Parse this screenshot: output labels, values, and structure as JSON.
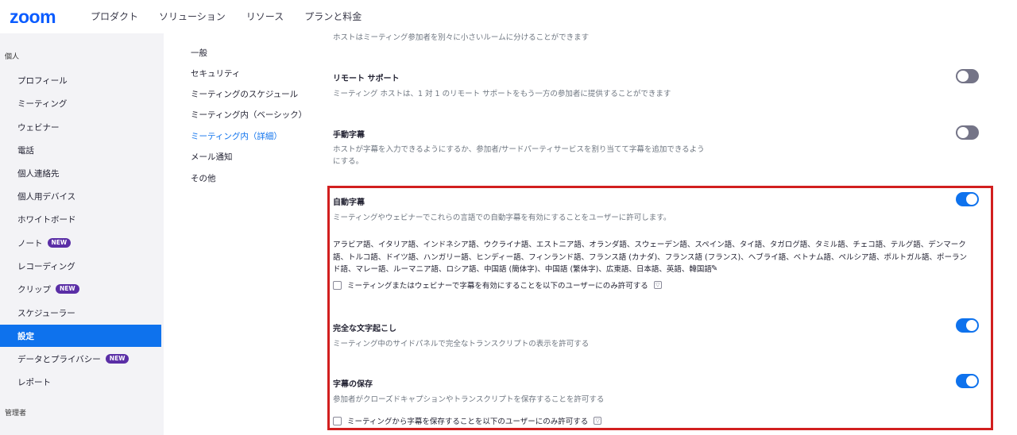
{
  "header": {
    "logo": "zoom",
    "nav": [
      "プロダクト",
      "ソリューション",
      "リソース",
      "プランと料金"
    ]
  },
  "sidebar": {
    "personal_label": "個人",
    "admin_label": "管理者",
    "items": [
      {
        "label": "プロフィール"
      },
      {
        "label": "ミーティング"
      },
      {
        "label": "ウェビナー"
      },
      {
        "label": "電話"
      },
      {
        "label": "個人連絡先"
      },
      {
        "label": "個人用デバイス"
      },
      {
        "label": "ホワイトボード"
      },
      {
        "label": "ノート",
        "badge": "NEW"
      },
      {
        "label": "レコーディング"
      },
      {
        "label": "クリップ",
        "badge": "NEW"
      },
      {
        "label": "スケジューラー"
      },
      {
        "label": "設定"
      },
      {
        "label": "データとプライバシー",
        "badge": "NEW"
      },
      {
        "label": "レポート"
      }
    ]
  },
  "subnav": [
    "一般",
    "セキュリティ",
    "ミーティングのスケジュール",
    "ミーティング内（ベーシック）",
    "ミーティング内（詳細）",
    "メール通知",
    "その他"
  ],
  "settings": {
    "breakout_desc": "ホストはミーティング参加者を別々に小さいルームに分けることができます",
    "remote_support": {
      "title": "リモート サポート",
      "desc": "ミーティング ホストは、1 対 1 のリモート サポートをもう一方の参加者に提供することができます"
    },
    "manual_captions": {
      "title": "手動字幕",
      "desc_line1": "ホストが字幕を入力できるようにするか、参加者/サードパーティサービスを割り当てて字幕を追加できるよう",
      "desc_line2": "にする。"
    },
    "auto_captions": {
      "title": "自動字幕",
      "desc": "ミーティングやウェビナーでこれらの言語での自動字幕を有効にすることをユーザーに許可します。",
      "languages": "アラビア語、イタリア語、インドネシア語、ウクライナ語、エストニア語、オランダ語、スウェーデン語、スペイン語、タイ語、タガログ語、タミル語、チェコ語、テルグ語、デンマーク語、トルコ語、ドイツ語、ハンガリー語、ヒンディー語、フィンランド語、フランス語 (カナダ)、フランス語 (フランス)、ヘブライ語、ベトナム語、ペルシア語、ポルトガル語、ポーランド語、マレー語、ルーマニア語、ロシア語、中国語 (簡体字)、中国語 (繁体字)、広東語、日本語、英語、韓国語",
      "checkbox_label": "ミーティングまたはウェビナーで字幕を有効にすることを以下のユーザーにのみ許可する"
    },
    "full_transcript": {
      "title": "完全な文字起こし",
      "desc": "ミーティング中のサイドパネルで完全なトランスクリプトの表示を許可する"
    },
    "save_captions": {
      "title": "字幕の保存",
      "desc": "参加者がクローズドキャプションやトランスクリプトを保存することを許可する",
      "checkbox_label": "ミーティングから字幕を保存することを以下のユーザーにのみ許可する"
    }
  },
  "colors": {
    "brand": "#0b5cff",
    "toggle_on": "#0e72ed",
    "toggle_off": "#747487",
    "highlight": "#d21f1f"
  }
}
